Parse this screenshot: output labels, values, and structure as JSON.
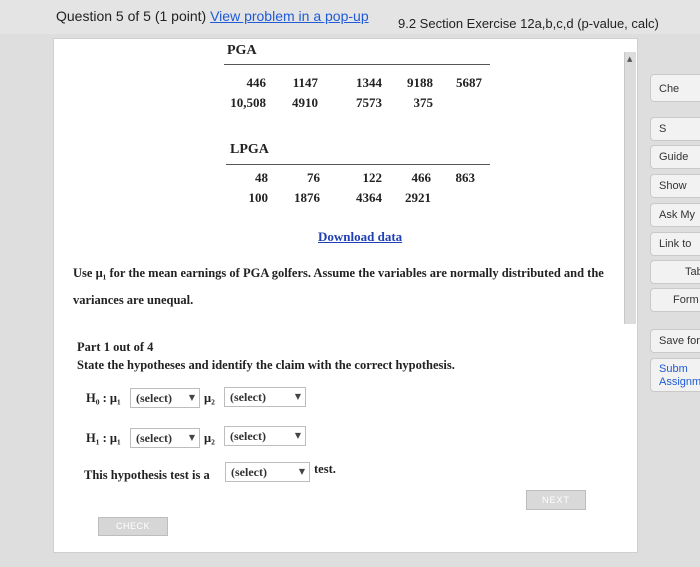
{
  "header": {
    "question_label": "Question 5 of 5 (1 point)",
    "popup_link": "View problem in a pop-up",
    "exercise_title": "9.2 Section Exercise 12a,b,c,d (p-value, calc)"
  },
  "pga": {
    "label": "PGA",
    "rows": [
      [
        "446",
        "1147",
        "1344",
        "9188",
        "5687"
      ],
      [
        "10,508",
        "4910",
        "7573",
        "375"
      ]
    ]
  },
  "lpga": {
    "label": "LPGA",
    "rows": [
      [
        "48",
        "76",
        "122",
        "466",
        "863"
      ],
      [
        "100",
        "1876",
        "4364",
        "2921"
      ]
    ]
  },
  "download_link": "Download data",
  "instructions": "Use μ₁ for the mean earnings of PGA golfers. Assume the variables are normally distributed and the variances are unequal.",
  "part": {
    "label": "Part 1 out of 4",
    "prompt": "State the hypotheses and identify the claim with the correct hypothesis."
  },
  "hypotheses": {
    "h0_label": "H₀ : μ₁",
    "h1_label": "H₁ : μ₁",
    "mu2": "μ₂",
    "select_placeholder": "(select)",
    "test_prefix": "This hypothesis test is a",
    "test_suffix": "test."
  },
  "buttons": {
    "next": "NEXT",
    "check": "CHECK"
  },
  "sidebar": {
    "items": [
      "Che",
      "S",
      "Guide",
      "Show",
      "Ask My",
      "Link to",
      "Tab",
      "Form",
      "Save for",
      "Subm Assignm"
    ]
  }
}
